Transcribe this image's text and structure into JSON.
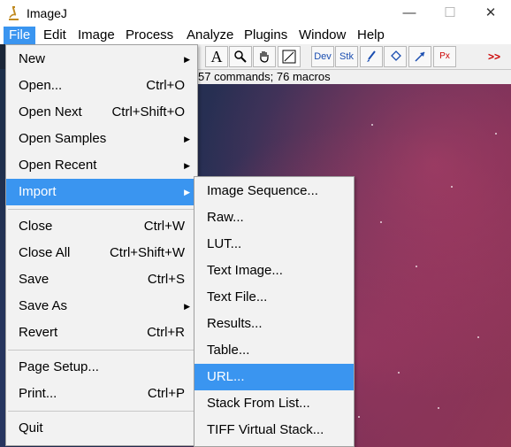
{
  "window": {
    "title": "ImageJ",
    "minimize": "—",
    "maximize": "☐",
    "close": "✕"
  },
  "menubar": [
    "File",
    "Edit",
    "Image",
    "Process",
    "Analyze",
    "Plugins",
    "Window",
    "Help"
  ],
  "toolbar": {
    "text_tool": "A",
    "magnify": "🔍",
    "hand": "✋",
    "color_picker": "⟋",
    "dev": "Dev",
    "stk": "Stk",
    "brush": "🖌",
    "flood": "◈",
    "arrow": "↗",
    "px": "Px",
    "more": ">>"
  },
  "status": "57 commands; 76 macros",
  "file_menu": [
    {
      "label": "New",
      "shortcut": "",
      "submenu": true
    },
    {
      "label": "Open...",
      "shortcut": "Ctrl+O",
      "submenu": false
    },
    {
      "label": "Open Next",
      "shortcut": "Ctrl+Shift+O",
      "submenu": false
    },
    {
      "label": "Open Samples",
      "shortcut": "",
      "submenu": true
    },
    {
      "label": "Open Recent",
      "shortcut": "",
      "submenu": true
    },
    {
      "label": "Import",
      "shortcut": "",
      "submenu": true
    },
    {
      "label": "Close",
      "shortcut": "Ctrl+W",
      "submenu": false
    },
    {
      "label": "Close All",
      "shortcut": "Ctrl+Shift+W",
      "submenu": false
    },
    {
      "label": "Save",
      "shortcut": "Ctrl+S",
      "submenu": false
    },
    {
      "label": "Save As",
      "shortcut": "",
      "submenu": true
    },
    {
      "label": "Revert",
      "shortcut": "Ctrl+R",
      "submenu": false
    },
    {
      "label": "Page Setup...",
      "shortcut": "",
      "submenu": false
    },
    {
      "label": "Print...",
      "shortcut": "Ctrl+P",
      "submenu": false
    },
    {
      "label": "Quit",
      "shortcut": "",
      "submenu": false
    }
  ],
  "import_menu": [
    "Image Sequence...",
    "Raw...",
    "LUT...",
    "Text Image...",
    "Text File...",
    "Results...",
    "Table...",
    "URL...",
    "Stack From List...",
    "TIFF Virtual Stack..."
  ],
  "arrow_glyph": "▶",
  "colors": {
    "highlight": "#3a95f0"
  }
}
